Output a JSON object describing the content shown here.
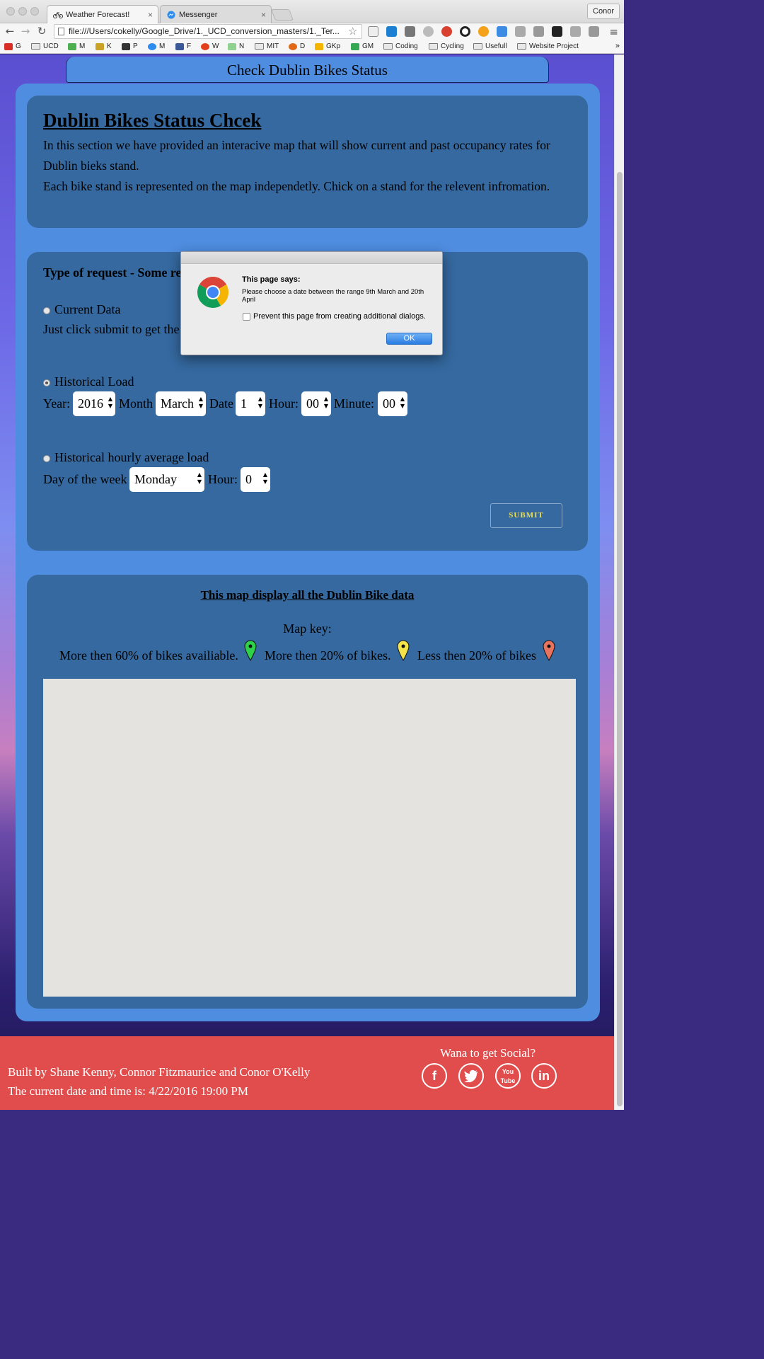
{
  "browser": {
    "tabs": [
      {
        "label": "Weather Forecast!"
      },
      {
        "label": "Messenger"
      }
    ],
    "profile": "Conor",
    "url": "file:///Users/cokelly/Google_Drive/1._UCD_conversion_masters/1._Ter...",
    "bookmarks": [
      {
        "label": "G"
      },
      {
        "label": "UCD"
      },
      {
        "label": "M"
      },
      {
        "label": "K"
      },
      {
        "label": "P"
      },
      {
        "label": "M"
      },
      {
        "label": "F"
      },
      {
        "label": "W"
      },
      {
        "label": "N"
      },
      {
        "label": "MIT"
      },
      {
        "label": "D"
      },
      {
        "label": "GKp"
      },
      {
        "label": "GM"
      },
      {
        "label": "Coding"
      },
      {
        "label": "Cycling"
      },
      {
        "label": "Usefull"
      },
      {
        "label": "Website Project"
      }
    ],
    "bookmarks_more": "»"
  },
  "page": {
    "header": "Check Dublin Bikes Status",
    "intro": {
      "title": "Dublin Bikes Status Chcek",
      "line1": "In this section we have provided an interacive map that will show current and past occupancy rates for Dublin bieks stand.",
      "line2": "Each bike stand is represented on the map independetly. Chick on a stand for the relevent infromation."
    },
    "request": {
      "title": "Type of request - Some re",
      "current": {
        "label": "Current Data",
        "desc": "Just click submit to get the"
      },
      "historical": {
        "label": "Historical Load",
        "year_label": "Year:",
        "year": "2016",
        "month_label": "Month",
        "month": "March",
        "date_label": "Date",
        "date": "1",
        "hour_label": "Hour:",
        "hour": "00",
        "minute_label": "Minute:",
        "minute": "00"
      },
      "hourly": {
        "label": "Historical hourly average load",
        "day_label": "Day of the week",
        "day": "Monday",
        "hour_label": "Hour:",
        "hour": "0"
      },
      "submit": "SUBMIT"
    },
    "map": {
      "title": "This map display all the Dublin Bike data",
      "key_label": "Map key:",
      "key_high": "More then 60% of bikes availiable.",
      "key_mid": "More then 20% of bikes.",
      "key_low": "Less then 20% of bikes",
      "colors": {
        "high": "#2fd14a",
        "mid": "#f4e44a",
        "low": "#e8735f"
      }
    },
    "footer": {
      "built_by": "Built by Shane Kenny, Connor Fitzmaurice and Conor O'Kelly",
      "datetime": "The current date and time is: 4/22/2016 19:00 PM",
      "social_heading": "Wana to get Social?",
      "social_icons": [
        "facebook-icon",
        "twitter-icon",
        "youtube-icon",
        "linkedin-icon"
      ]
    }
  },
  "dialog": {
    "title": "This page says:",
    "message": "Please choose a date between the range 9th March and 20th April",
    "checkbox_label": "Prevent this page from creating additional dialogs.",
    "ok": "OK"
  }
}
